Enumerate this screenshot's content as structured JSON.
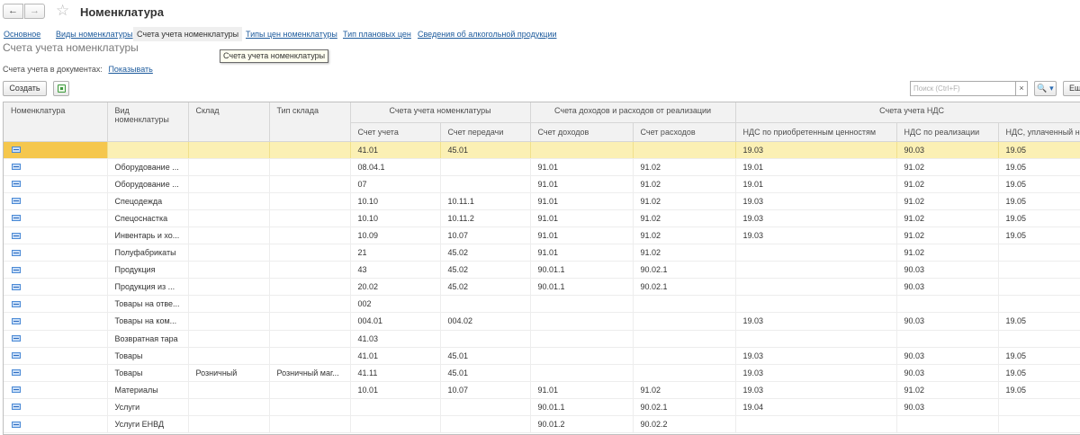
{
  "window": {
    "title": "Номенклатура",
    "back_icon": "←",
    "forward_icon": "→",
    "star_icon": "☆"
  },
  "tabs": [
    {
      "label": "Основное",
      "active": false
    },
    {
      "label": "Виды номенклатуры",
      "active": false
    },
    {
      "label": "Счета учета номенклатуры",
      "active": true
    },
    {
      "label": "Типы цен номенклатуры",
      "active": false
    },
    {
      "label": "Тип плановых цен",
      "active": false
    },
    {
      "label": "Сведения об алкогольной продукции",
      "active": false
    }
  ],
  "section_title": "Счета учета номенклатуры",
  "tooltip": "Счета учета номенклатуры",
  "docs": {
    "label": "Счета учета в документах:",
    "link": "Показывать"
  },
  "toolbar": {
    "create_label": "Создать",
    "copy_icon": "copy-icon",
    "search_placeholder": "Поиск (Ctrl+F)",
    "search_clear": "×",
    "search_button": "🔍 ▾",
    "more_label": "Ещ"
  },
  "table": {
    "groups": {
      "nomenclature_accounts": "Счета учета номенклатуры",
      "income_expense": "Счета доходов и расходов от реализации",
      "vat_accounts": "Счета учета НДС"
    },
    "columns": {
      "nomenclature": "Номенклатура",
      "kind": "Вид номенклатуры",
      "warehouse": "Склад",
      "warehouse_type": "Тип склада",
      "account": "Счет учета",
      "transfer_account": "Счет передачи",
      "income_account": "Счет доходов",
      "expense_account": "Счет расходов",
      "vat_acquired": "НДС по приобретенным ценностям",
      "vat_sales": "НДС по реализации",
      "vat_paid": "НДС, уплаченный на"
    },
    "rows": [
      [
        "",
        "",
        "",
        "",
        "41.01",
        "45.01",
        "",
        "",
        "19.03",
        "90.03",
        "19.05"
      ],
      [
        "",
        "Оборудование ...",
        "",
        "",
        "08.04.1",
        "",
        "91.01",
        "91.02",
        "19.01",
        "91.02",
        "19.05"
      ],
      [
        "",
        "Оборудование ...",
        "",
        "",
        "07",
        "",
        "91.01",
        "91.02",
        "19.01",
        "91.02",
        "19.05"
      ],
      [
        "",
        "Спецодежда",
        "",
        "",
        "10.10",
        "10.11.1",
        "91.01",
        "91.02",
        "19.03",
        "91.02",
        "19.05"
      ],
      [
        "",
        "Спецоснастка",
        "",
        "",
        "10.10",
        "10.11.2",
        "91.01",
        "91.02",
        "19.03",
        "91.02",
        "19.05"
      ],
      [
        "",
        "Инвентарь и хо...",
        "",
        "",
        "10.09",
        "10.07",
        "91.01",
        "91.02",
        "19.03",
        "91.02",
        "19.05"
      ],
      [
        "",
        "Полуфабрикаты",
        "",
        "",
        "21",
        "45.02",
        "91.01",
        "91.02",
        "",
        "91.02",
        ""
      ],
      [
        "",
        "Продукция",
        "",
        "",
        "43",
        "45.02",
        "90.01.1",
        "90.02.1",
        "",
        "90.03",
        ""
      ],
      [
        "",
        "Продукция из ...",
        "",
        "",
        "20.02",
        "45.02",
        "90.01.1",
        "90.02.1",
        "",
        "90.03",
        ""
      ],
      [
        "",
        "Товары на отве...",
        "",
        "",
        "002",
        "",
        "",
        "",
        "",
        "",
        ""
      ],
      [
        "",
        "Товары на ком...",
        "",
        "",
        "004.01",
        "004.02",
        "",
        "",
        "19.03",
        "90.03",
        "19.05"
      ],
      [
        "",
        "Возвратная тара",
        "",
        "",
        "41.03",
        "",
        "",
        "",
        "",
        "",
        ""
      ],
      [
        "",
        "Товары",
        "",
        "",
        "41.01",
        "45.01",
        "",
        "",
        "19.03",
        "90.03",
        "19.05"
      ],
      [
        "",
        "Товары",
        "Розничный",
        "Розничный маг...",
        "41.11",
        "45.01",
        "",
        "",
        "19.03",
        "90.03",
        "19.05"
      ],
      [
        "",
        "Материалы",
        "",
        "",
        "10.01",
        "10.07",
        "91.01",
        "91.02",
        "19.03",
        "91.02",
        "19.05"
      ],
      [
        "",
        "Услуги",
        "",
        "",
        "",
        "",
        "90.01.1",
        "90.02.1",
        "19.04",
        "90.03",
        ""
      ],
      [
        "",
        "Услуги ЕНВД",
        "",
        "",
        "",
        "",
        "90.01.2",
        "90.02.2",
        "",
        "",
        ""
      ]
    ]
  }
}
